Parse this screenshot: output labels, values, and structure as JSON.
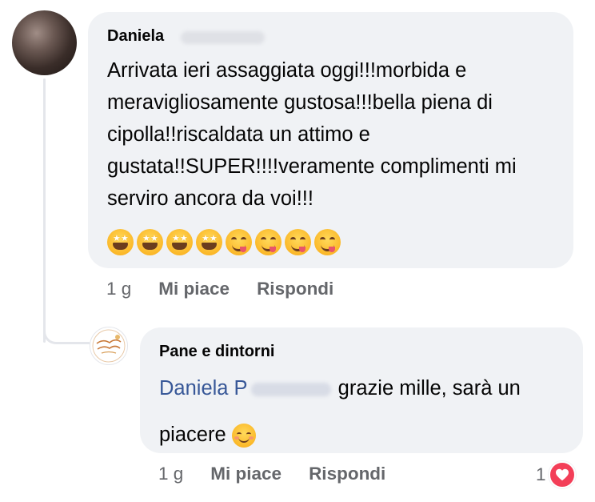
{
  "comment": {
    "author_name": "Daniela",
    "text": "Arrivata ieri assaggiata oggi!!!morbida e meravigliosamente gustosa!!!bella piena di cipolla!!riscaldata un attimo e gustata!!SUPER!!!!veramente complimenti mi serviro ancora da voi!!!",
    "emojis": [
      "star-struck-emoji",
      "star-struck-emoji",
      "star-struck-emoji",
      "star-struck-emoji",
      "yum-emoji",
      "yum-emoji",
      "yum-emoji",
      "yum-emoji"
    ],
    "time": "1 g",
    "like_label": "Mi piace",
    "reply_label": "Rispondi"
  },
  "reply": {
    "author_name": "Pane e dintorni",
    "mention": "Daniela P",
    "text_line1": "grazie mille, sarà un",
    "text_line2": "piacere",
    "time": "1 g",
    "like_label": "Mi piace",
    "reply_label": "Rispondi",
    "reaction_count": "1",
    "reaction_icon": "heart-icon",
    "reaction_color": "#f33e58"
  },
  "colors": {
    "bubble": "#f0f2f5",
    "mention": "#385898",
    "meta": "#65676b"
  }
}
